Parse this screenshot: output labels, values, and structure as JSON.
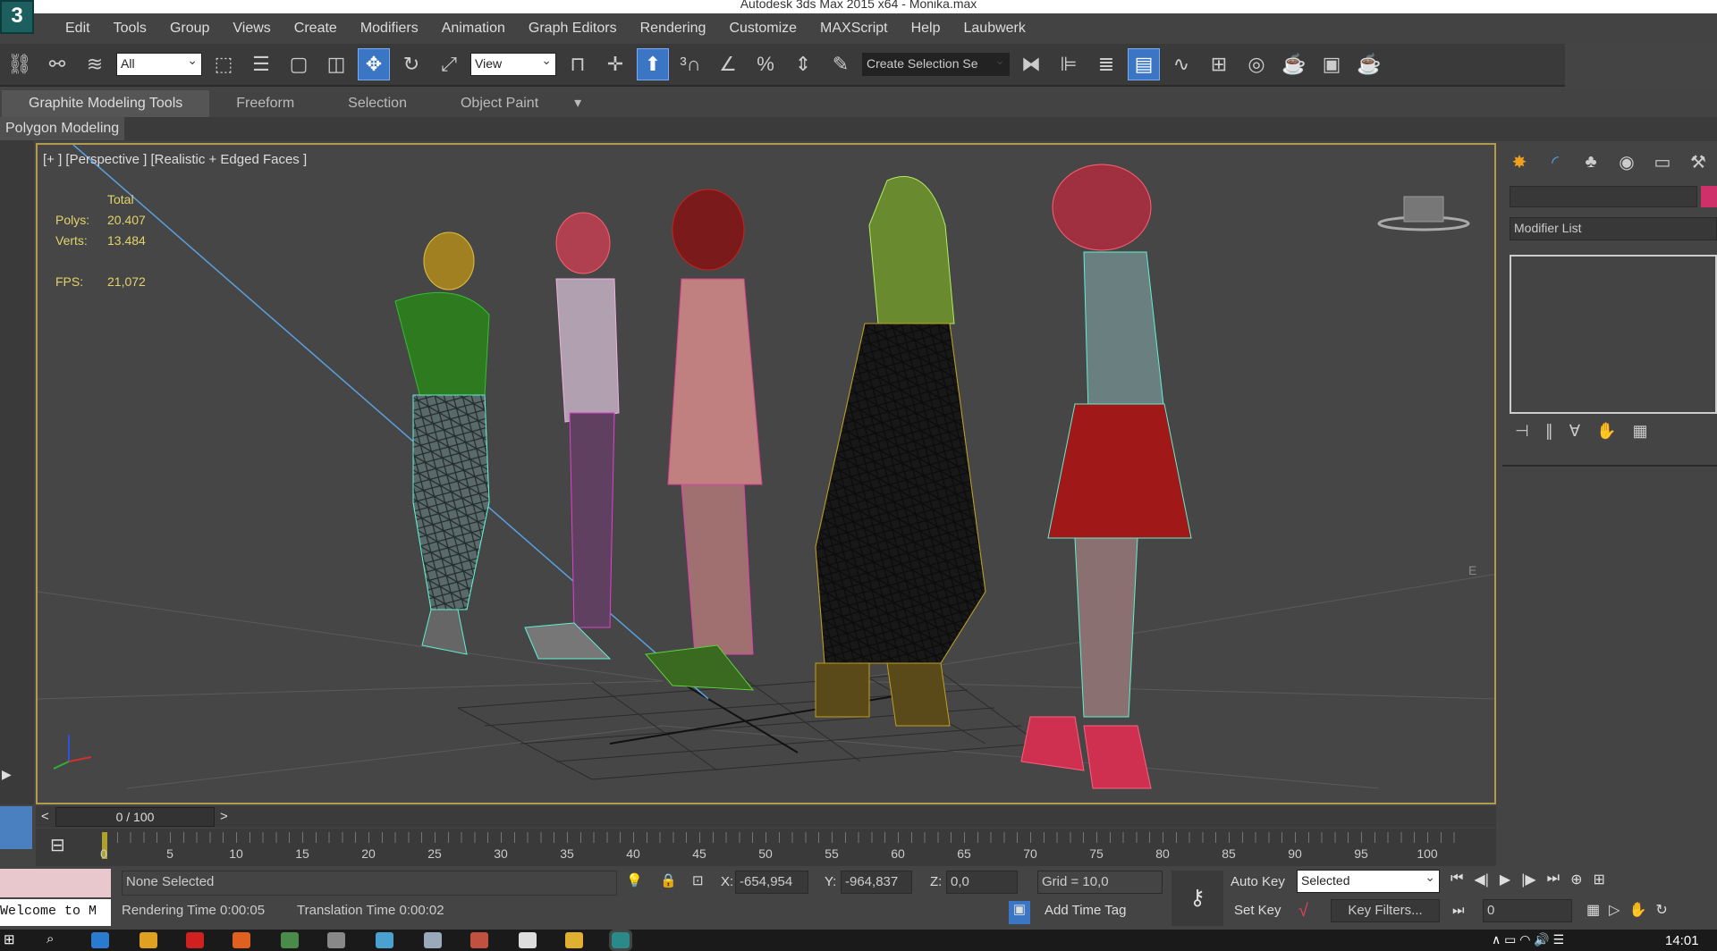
{
  "window": {
    "title": "Autodesk 3ds Max 2015 x64 - Monika.max",
    "app_icon": "3ds-max-logo-icon"
  },
  "menu": [
    "Edit",
    "Tools",
    "Group",
    "Views",
    "Create",
    "Modifiers",
    "Animation",
    "Graph Editors",
    "Rendering",
    "Customize",
    "MAXScript",
    "Help",
    "Laubwerk"
  ],
  "toolbar": {
    "selection_filter": "All",
    "reference_coord": "View",
    "named_selection": "Create Selection Se"
  },
  "ribbon": {
    "tabs": [
      "Graphite Modeling Tools",
      "Freeform",
      "Selection",
      "Object Paint"
    ],
    "panel": "Polygon Modeling"
  },
  "viewport": {
    "label": "[+ ] [Perspective ] [Realistic + Edged Faces ]",
    "stats_header": "Total",
    "polys_label": "Polys:",
    "polys": "20.407",
    "verts_label": "Verts:",
    "verts": "13.484",
    "fps_label": "FPS:",
    "fps": "21,072",
    "compass": "E"
  },
  "command_panel": {
    "modifier_list": "Modifier List",
    "color_swatch": "#d0306a"
  },
  "timeslider": {
    "value": "0 / 100",
    "prev": "<",
    "next": ">"
  },
  "trackbar": {
    "ticks": [
      "0",
      "5",
      "10",
      "15",
      "20",
      "25",
      "30",
      "35",
      "40",
      "45",
      "50",
      "55",
      "60",
      "65",
      "70",
      "75",
      "80",
      "85",
      "90",
      "95",
      "100"
    ]
  },
  "status": {
    "selection": "None Selected",
    "x_label": "X:",
    "x": "-654,954",
    "y_label": "Y:",
    "y": "-964,837",
    "z_label": "Z:",
    "z": "0,0",
    "grid": "Grid = 10,0",
    "rendering_time": "Rendering Time  0:00:05",
    "translation_time": "Translation Time  0:00:02",
    "add_time_tag": "Add Time Tag",
    "auto_key": "Auto Key",
    "set_key": "Set Key",
    "key_mode": "Selected",
    "key_filters": "Key Filters...",
    "frame": "0",
    "maxscript": "Welcome to M"
  },
  "taskbar": {
    "time": "14:01"
  }
}
